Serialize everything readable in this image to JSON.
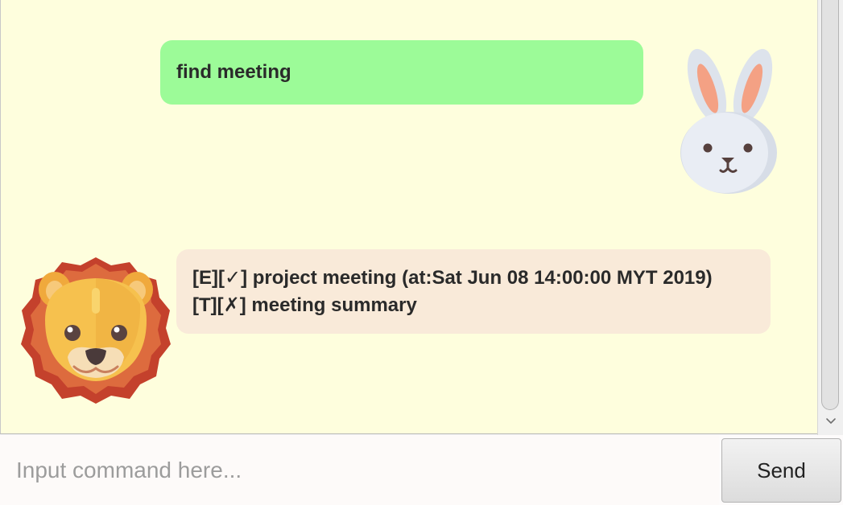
{
  "chat": {
    "user_message": "find meeting",
    "bot_lines": [
      "[E][✓] project meeting (at:Sat Jun 08 14:00:00 MYT 2019)",
      "[T][✗] meeting summary"
    ],
    "user_avatar_icon": "rabbit-icon",
    "bot_avatar_icon": "lion-icon",
    "user_bubble_color": "#9cfb98",
    "bot_bubble_color": "#f9ead9",
    "background_color": "#fefedd"
  },
  "input": {
    "placeholder": "Input command here...",
    "value": "",
    "send_label": "Send"
  }
}
